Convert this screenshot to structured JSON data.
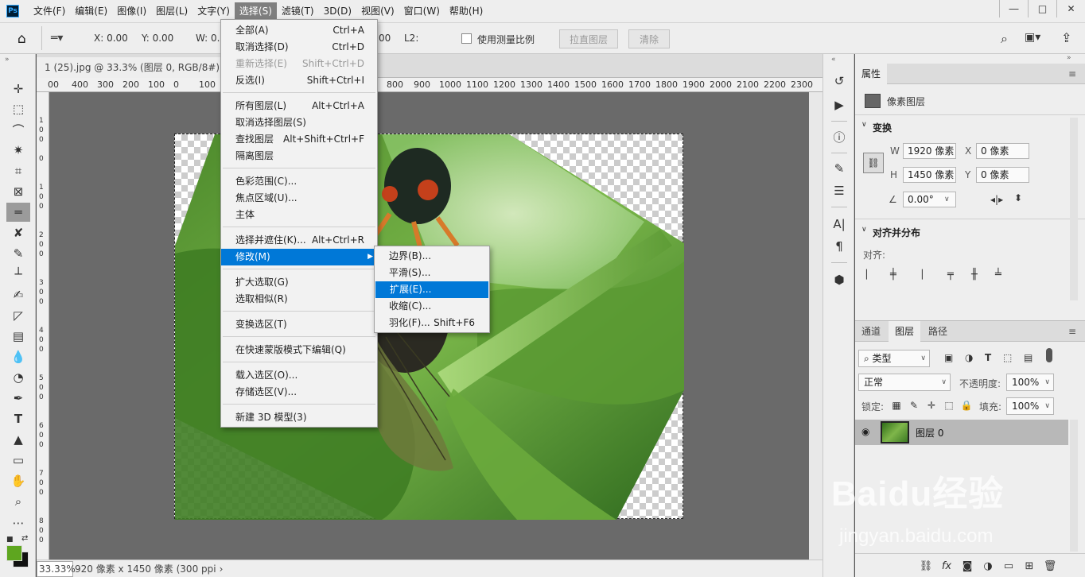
{
  "menubar": {
    "logo": "Ps",
    "items": [
      "文件(F)",
      "编辑(E)",
      "图像(I)",
      "图层(L)",
      "文字(Y)",
      "选择(S)",
      "滤镜(T)",
      "3D(D)",
      "视图(V)",
      "窗口(W)",
      "帮助(H)"
    ],
    "active_index": 5,
    "window_controls": [
      "minimize-icon",
      "restore-icon",
      "close-icon"
    ]
  },
  "options": {
    "x_label": "X: 0.00",
    "y_label": "Y: 0.00",
    "w_label": "W: 0.",
    "hidden_value": "00",
    "l2_label": "L2:",
    "use_measure_scale": "使用测量比例",
    "straighten_button": "拉直图层",
    "clear_button": "清除"
  },
  "document": {
    "tab_title": "1 (25).jpg @ 33.3% (图层 0, RGB/8#) *",
    "ruler_labels": [
      "00",
      "400",
      "300",
      "200",
      "100",
      "0",
      "100",
      "800",
      "900",
      "1000",
      "1100",
      "1200",
      "1300",
      "1400",
      "1500",
      "1600",
      "1700",
      "1800",
      "1900",
      "2000",
      "2100",
      "2200",
      "2300"
    ],
    "zoom": "33.33%",
    "status": "920 像素 x 1450 像素 (300 ppi"
  },
  "select_menu": {
    "items": [
      {
        "label": "全部(A)",
        "shortcut": "Ctrl+A"
      },
      {
        "label": "取消选择(D)",
        "shortcut": "Ctrl+D"
      },
      {
        "label": "重新选择(E)",
        "shortcut": "Shift+Ctrl+D",
        "disabled": true
      },
      {
        "label": "反选(I)",
        "shortcut": "Shift+Ctrl+I"
      },
      {
        "label": "所有图层(L)",
        "shortcut": "Alt+Ctrl+A"
      },
      {
        "label": "取消选择图层(S)",
        "shortcut": ""
      },
      {
        "label": "查找图层",
        "shortcut": "Alt+Shift+Ctrl+F"
      },
      {
        "label": "隔离图层",
        "shortcut": ""
      },
      {
        "label": "色彩范围(C)...",
        "shortcut": ""
      },
      {
        "label": "焦点区域(U)...",
        "shortcut": ""
      },
      {
        "label": "主体",
        "shortcut": ""
      },
      {
        "label": "选择并遮住(K)...",
        "shortcut": "Alt+Ctrl+R"
      },
      {
        "label": "修改(M)",
        "shortcut": "",
        "highlighted": true
      },
      {
        "label": "扩大选取(G)",
        "shortcut": ""
      },
      {
        "label": "选取相似(R)",
        "shortcut": ""
      },
      {
        "label": "变换选区(T)",
        "shortcut": ""
      },
      {
        "label": "在快速蒙版模式下编辑(Q)",
        "shortcut": ""
      },
      {
        "label": "载入选区(O)...",
        "shortcut": ""
      },
      {
        "label": "存储选区(V)...",
        "shortcut": ""
      },
      {
        "label": "新建 3D 模型(3)",
        "shortcut": ""
      }
    ]
  },
  "modify_menu": {
    "items": [
      {
        "label": "边界(B)...",
        "shortcut": ""
      },
      {
        "label": "平滑(S)...",
        "shortcut": ""
      },
      {
        "label": "扩展(E)...",
        "shortcut": "",
        "highlighted": true
      },
      {
        "label": "收缩(C)...",
        "shortcut": ""
      },
      {
        "label": "羽化(F)...",
        "shortcut": "Shift+F6"
      }
    ]
  },
  "properties": {
    "tab": "属性",
    "layer_type": "像素图层",
    "transform_title": "变换",
    "w_label": "W",
    "w_value": "1920 像素",
    "h_label": "H",
    "h_value": "1450 像素",
    "x_label": "X",
    "x_value": "0 像素",
    "y_label": "Y",
    "y_value": "0 像素",
    "angle_value": "0.00°",
    "align_title": "对齐并分布",
    "align_label": "对齐:"
  },
  "layers": {
    "tabs": [
      "通道",
      "图层",
      "路径"
    ],
    "active_tab": 1,
    "filter_kind": "类型",
    "blend_mode": "正常",
    "opacity_label": "不透明度:",
    "opacity_value": "100%",
    "lock_label": "锁定:",
    "fill_label": "填充:",
    "fill_value": "100%",
    "layer_name": "图层 0"
  },
  "watermark": {
    "brand": "Baidu经验",
    "url": "jingyan.baidu.com"
  },
  "colors": {
    "menu_highlight": "#0078d7",
    "active_menu_bg": "#7f7f7f",
    "foreground_swatch": "#5ea61f",
    "background_swatch": "#111111"
  }
}
